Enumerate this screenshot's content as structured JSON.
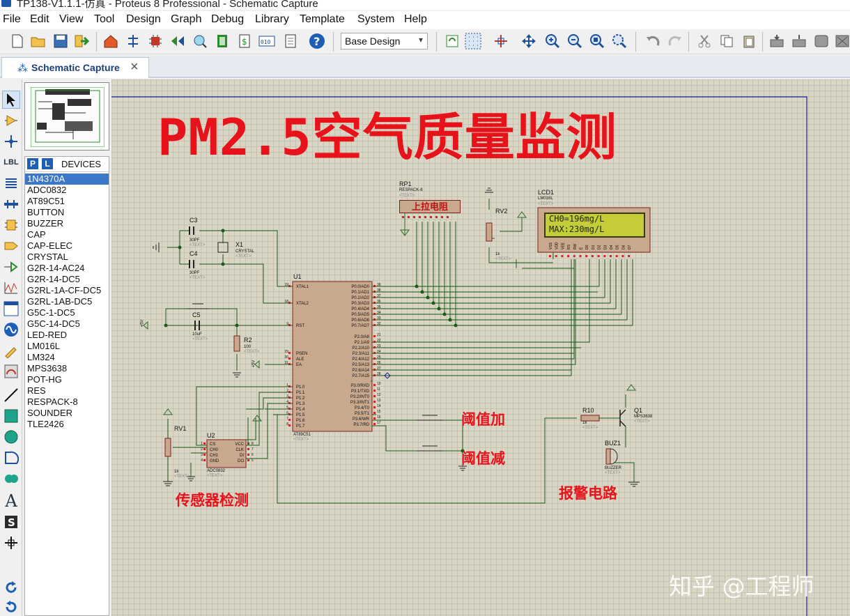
{
  "window": {
    "title": "TP138-V1.1.1-仿真 - Proteus 8 Professional - Schematic Capture"
  },
  "menu": [
    "File",
    "Edit",
    "View",
    "Tool",
    "Design",
    "Graph",
    "Debug",
    "Library",
    "Template",
    "System",
    "Help"
  ],
  "toolbar": {
    "design_select": "Base Design"
  },
  "tab": {
    "label": "Schematic Capture"
  },
  "devices": {
    "p_label": "P",
    "l_label": "L",
    "title": "DEVICES",
    "items": [
      "1N4370A",
      "ADC0832",
      "AT89C51",
      "BUTTON",
      "BUZZER",
      "CAP",
      "CAP-ELEC",
      "CRYSTAL",
      "G2R-14-AC24",
      "G2R-14-DC5",
      "G2RL-1A-CF-DC5",
      "G2RL-1AB-DC5",
      "G5C-1-DC5",
      "G5C-14-DC5",
      "LED-RED",
      "LM016L",
      "LM324",
      "MPS3638",
      "POT-HG",
      "RES",
      "RESPACK-8",
      "SOUNDER",
      "TLE2426"
    ],
    "selected": "1N4370A"
  },
  "schematic": {
    "title": "PM2.5空气质量监测",
    "section_labels": {
      "sensor": "传感器检测",
      "alarm": "报警电路",
      "threshold_up": "阈值加",
      "threshold_down": "阈值减",
      "pullup": "上拉电阻"
    },
    "lcd": {
      "ref": "LCD1",
      "part": "LM016L",
      "line1": "CH0=196mg/L",
      "line2": "MAX:230mg/L"
    },
    "components": {
      "u1": {
        "ref": "U1",
        "part": "AT89C51"
      },
      "u2": {
        "ref": "U2",
        "part": "ADC0832"
      },
      "rp1": {
        "ref": "RP1",
        "part": "RESPACK-8"
      },
      "rv1": {
        "ref": "RV1",
        "value": "1k"
      },
      "rv2": {
        "ref": "RV2",
        "value": "1k"
      },
      "c3": {
        "ref": "C3",
        "value": "30PF"
      },
      "c4": {
        "ref": "C4",
        "value": "30PF"
      },
      "c5": {
        "ref": "C5",
        "value": "10uF"
      },
      "x1": {
        "ref": "X1",
        "part": "CRYSTAL"
      },
      "r2": {
        "ref": "R2",
        "value": "100"
      },
      "r10": {
        "ref": "R10",
        "value": "1k"
      },
      "q1": {
        "ref": "Q1",
        "part": "MPS3638"
      },
      "buz1": {
        "ref": "BUZ1",
        "part": "BUZZER"
      }
    },
    "text_placeholder": "<TEXT>",
    "u1_pins_left": [
      "XTAL1",
      "XTAL2",
      "RST",
      "PSEN",
      "ALE",
      "EA",
      "P1.0",
      "P1.1",
      "P1.2",
      "P1.3",
      "P1.4",
      "P1.5",
      "P1.6",
      "P1.7"
    ],
    "u1_pins_right": [
      "P0.0/AD0",
      "P0.1/AD1",
      "P0.2/AD2",
      "P0.3/AD3",
      "P0.4/AD4",
      "P0.5/AD5",
      "P0.6/AD6",
      "P0.7/AD7",
      "P2.0/A8",
      "P2.1/A9",
      "P2.2/A10",
      "P2.3/A11",
      "P2.4/A12",
      "P2.5/A13",
      "P2.6/A14",
      "P2.7/A15",
      "P3.0/RXD",
      "P3.1/TXD",
      "P3.2/INT0",
      "P3.3/INT1",
      "P3.4/T0",
      "P3.5/T1",
      "P3.6/WR",
      "P3.7/RD"
    ],
    "u1_pinnums_left": [
      "19",
      "18",
      "9",
      "29",
      "30",
      "31",
      "1",
      "2",
      "3",
      "4",
      "5",
      "6",
      "7",
      "8"
    ],
    "u1_pinnums_right": [
      "39",
      "38",
      "37",
      "36",
      "35",
      "34",
      "33",
      "32",
      "21",
      "22",
      "23",
      "24",
      "25",
      "26",
      "27",
      "28",
      "10",
      "11",
      "12",
      "13",
      "14",
      "15",
      "16",
      "17"
    ],
    "u2_pins_left": [
      "CS",
      "CH0",
      "CH1",
      "GND"
    ],
    "u2_pins_right": [
      "VCC",
      "CLK",
      "DI",
      "DO"
    ],
    "lcd_pins": [
      "VSS",
      "VDD",
      "VEE",
      "RS",
      "RW",
      "E",
      "D0",
      "D1",
      "D2",
      "D3",
      "D4",
      "D5",
      "D6",
      "D7"
    ],
    "power_labels": {
      "plus5v": "+5V"
    }
  },
  "watermark": "知乎 @工程师"
}
